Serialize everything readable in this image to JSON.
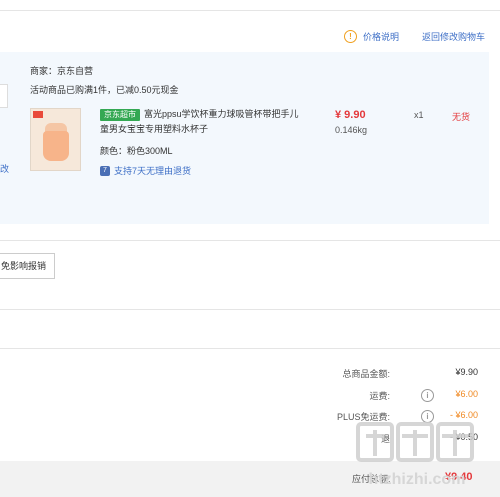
{
  "header": {
    "price_note": "价格说明",
    "back_to_cart": "返回修改购物车"
  },
  "order": {
    "left_fragment": "改",
    "seller": "商家：京东自营",
    "promo": "活动商品已购满1件，已减0.50元现金",
    "item": {
      "badge": "京东超市",
      "title": "富光ppsu学饮杯重力球吸管杯带把手儿童男女宝宝专用塑料水杯子",
      "color": "颜色：粉色300ML",
      "returns": "支持7天无理由退货",
      "price": "¥ 9.90",
      "weight": "0.146kg",
      "qty": "x1",
      "stock": "无货"
    }
  },
  "invoice_button": "免影响报销",
  "summary": {
    "rows": [
      {
        "label": "总商品金额:",
        "value": "¥9.90"
      },
      {
        "label": "运费:",
        "value": "¥6.00"
      },
      {
        "label": "PLUS免运费:",
        "value": "- ¥6.00"
      },
      {
        "label": "退",
        "value": "- ¥0.50"
      }
    ]
  },
  "footer": {
    "label": "应付总额:",
    "amount": "¥9.40"
  },
  "watermark": {
    "text": "什么值得买",
    "site": "htzhizhi.com"
  },
  "colors": {
    "link": "#3c6ec6",
    "price_red": "#e4393c",
    "accent_orange": "#f08a24",
    "jd_green": "#34a853",
    "block_bg": "#f3f8fd"
  }
}
